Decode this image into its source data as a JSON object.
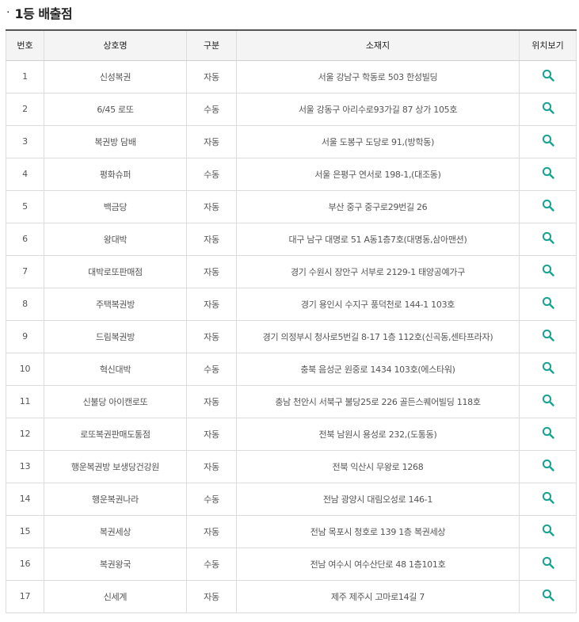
{
  "section": {
    "bullet": "·",
    "title": "1등 배출점"
  },
  "table": {
    "headers": {
      "no": "번호",
      "name": "상호명",
      "type": "구분",
      "address": "소재지",
      "location": "위치보기"
    },
    "rows": [
      {
        "no": "1",
        "name": "신성복권",
        "type": "자동",
        "address": "서울 강남구 학동로 503 한성빌딩"
      },
      {
        "no": "2",
        "name": "6/45 로또",
        "type": "수동",
        "address": "서울 강동구 아리수로93가길 87 상가 105호"
      },
      {
        "no": "3",
        "name": "복권방 담배",
        "type": "자동",
        "address": "서울 도봉구 도당로 91,(방학동)"
      },
      {
        "no": "4",
        "name": "평화슈퍼",
        "type": "수동",
        "address": "서울 은평구 연서로 198-1,(대조동)"
      },
      {
        "no": "5",
        "name": "백금당",
        "type": "자동",
        "address": "부산 중구 중구로29번길 26"
      },
      {
        "no": "6",
        "name": "왕대박",
        "type": "자동",
        "address": "대구 남구 대명로 51 A동1층7호(대명동,삼아맨션)"
      },
      {
        "no": "7",
        "name": "대박로또판매점",
        "type": "자동",
        "address": "경기 수원시 장안구 서부로 2129-1 태양공예가구"
      },
      {
        "no": "8",
        "name": "주택복권방",
        "type": "자동",
        "address": "경기 용인시 수지구 풍덕천로 144-1 103호"
      },
      {
        "no": "9",
        "name": "드림복권방",
        "type": "자동",
        "address": "경기 의정부시 청사로5번길 8-17 1층 112호(신곡동,센타프라자)"
      },
      {
        "no": "10",
        "name": "혁신대박",
        "type": "수동",
        "address": "충북 음성군 원중로 1434 103호(에스타워)"
      },
      {
        "no": "11",
        "name": "신불당 아이캔로또",
        "type": "자동",
        "address": "충남 천안시 서북구 불당25로 226 골든스퀘어빌딩 118호"
      },
      {
        "no": "12",
        "name": "로또복권판매도통점",
        "type": "자동",
        "address": "전북 남원시 용성로 232,(도통동)"
      },
      {
        "no": "13",
        "name": "행운복권방 보생당건강원",
        "type": "자동",
        "address": "전북 익산시 무왕로 1268"
      },
      {
        "no": "14",
        "name": "행운복권나라",
        "type": "수동",
        "address": "전남 광양시 대림오성로 146-1"
      },
      {
        "no": "15",
        "name": "복권세상",
        "type": "자동",
        "address": "전남 목포시 청호로 139 1층 복권세상"
      },
      {
        "no": "16",
        "name": "복권왕국",
        "type": "수동",
        "address": "전남 여수시 여수산단로 48 1층101호"
      },
      {
        "no": "17",
        "name": "신세계",
        "type": "자동",
        "address": "제주 제주시 고마로14길 7"
      }
    ]
  },
  "icons": {
    "location": "search-icon"
  },
  "colors": {
    "icon": "#1aa392",
    "header_bg": "#f4f4f4",
    "top_border": "#555555"
  }
}
